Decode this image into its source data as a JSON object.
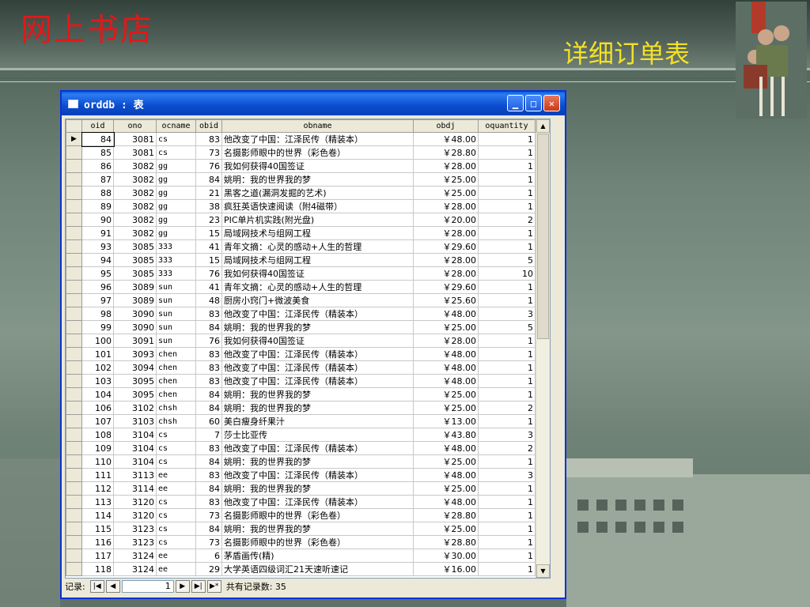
{
  "slide": {
    "title": "网上书店",
    "subtitle": "详细订单表"
  },
  "window": {
    "title": "orddb : 表",
    "columns": [
      "oid",
      "ono",
      "ocname",
      "obid",
      "obname",
      "obdj",
      "oquantity"
    ],
    "rows": [
      [
        "84",
        "3081",
        "cs",
        "83",
        "他改变了中国：江泽民传（精装本）",
        "￥48.00",
        "1"
      ],
      [
        "85",
        "3081",
        "cs",
        "73",
        "名摄影师眼中的世界（彩色卷）",
        "￥28.80",
        "1"
      ],
      [
        "86",
        "3082",
        "gg",
        "76",
        "我如何获得40国签证",
        "￥28.00",
        "1"
      ],
      [
        "87",
        "3082",
        "gg",
        "84",
        "姚明：我的世界我的梦",
        "￥25.00",
        "1"
      ],
      [
        "88",
        "3082",
        "gg",
        "21",
        "黑客之道(漏洞发掘的艺术)",
        "￥25.00",
        "1"
      ],
      [
        "89",
        "3082",
        "gg",
        "38",
        "疯狂英语快速阅读（附4磁带）",
        "￥28.00",
        "1"
      ],
      [
        "90",
        "3082",
        "gg",
        "23",
        "PIC单片机实践(附光盘)",
        "￥20.00",
        "2"
      ],
      [
        "91",
        "3082",
        "gg",
        "15",
        "局域网技术与组网工程",
        "￥28.00",
        "1"
      ],
      [
        "93",
        "3085",
        "333",
        "41",
        "青年文摘：心灵的感动+人生的哲理",
        "￥29.60",
        "1"
      ],
      [
        "94",
        "3085",
        "333",
        "15",
        "局域网技术与组网工程",
        "￥28.00",
        "5"
      ],
      [
        "95",
        "3085",
        "333",
        "76",
        "我如何获得40国签证",
        "￥28.00",
        "10"
      ],
      [
        "96",
        "3089",
        "sun",
        "41",
        "青年文摘：心灵的感动+人生的哲理",
        "￥29.60",
        "1"
      ],
      [
        "97",
        "3089",
        "sun",
        "48",
        "厨房小窍门+微波美食",
        "￥25.60",
        "1"
      ],
      [
        "98",
        "3090",
        "sun",
        "83",
        "他改变了中国：江泽民传（精装本）",
        "￥48.00",
        "3"
      ],
      [
        "99",
        "3090",
        "sun",
        "84",
        "姚明：我的世界我的梦",
        "￥25.00",
        "5"
      ],
      [
        "100",
        "3091",
        "sun",
        "76",
        "我如何获得40国签证",
        "￥28.00",
        "1"
      ],
      [
        "101",
        "3093",
        "chen",
        "83",
        "他改变了中国：江泽民传（精装本）",
        "￥48.00",
        "1"
      ],
      [
        "102",
        "3094",
        "chen",
        "83",
        "他改变了中国：江泽民传（精装本）",
        "￥48.00",
        "1"
      ],
      [
        "103",
        "3095",
        "chen",
        "83",
        "他改变了中国：江泽民传（精装本）",
        "￥48.00",
        "1"
      ],
      [
        "104",
        "3095",
        "chen",
        "84",
        "姚明：我的世界我的梦",
        "￥25.00",
        "1"
      ],
      [
        "106",
        "3102",
        "chsh",
        "84",
        "姚明：我的世界我的梦",
        "￥25.00",
        "2"
      ],
      [
        "107",
        "3103",
        "chsh",
        "60",
        "美白瘦身纤果汁",
        "￥13.00",
        "1"
      ],
      [
        "108",
        "3104",
        "cs",
        "7",
        "莎士比亚传",
        "￥43.80",
        "3"
      ],
      [
        "109",
        "3104",
        "cs",
        "83",
        "他改变了中国：江泽民传（精装本）",
        "￥48.00",
        "2"
      ],
      [
        "110",
        "3104",
        "cs",
        "84",
        "姚明：我的世界我的梦",
        "￥25.00",
        "1"
      ],
      [
        "111",
        "3113",
        "ee",
        "83",
        "他改变了中国：江泽民传（精装本）",
        "￥48.00",
        "3"
      ],
      [
        "112",
        "3114",
        "ee",
        "84",
        "姚明：我的世界我的梦",
        "￥25.00",
        "1"
      ],
      [
        "113",
        "3120",
        "cs",
        "83",
        "他改变了中国：江泽民传（精装本）",
        "￥48.00",
        "1"
      ],
      [
        "114",
        "3120",
        "cs",
        "73",
        "名摄影师眼中的世界（彩色卷）",
        "￥28.80",
        "1"
      ],
      [
        "115",
        "3123",
        "cs",
        "84",
        "姚明：我的世界我的梦",
        "￥25.00",
        "1"
      ],
      [
        "116",
        "3123",
        "cs",
        "73",
        "名摄影师眼中的世界（彩色卷）",
        "￥28.80",
        "1"
      ],
      [
        "117",
        "3124",
        "ee",
        "6",
        "茅盾画传(精)",
        "￥30.00",
        "1"
      ],
      [
        "118",
        "3124",
        "ee",
        "29",
        "大学英语四级词汇21天速听速记",
        "￥16.00",
        "1"
      ]
    ],
    "nav": {
      "label": "记录:",
      "current": "1",
      "total_text": "共有记录数: 35"
    }
  },
  "colors": {
    "title_red": "#e21818",
    "subtitle_yellow": "#f3e027",
    "titlebar_blue": "#0a4ccf"
  }
}
